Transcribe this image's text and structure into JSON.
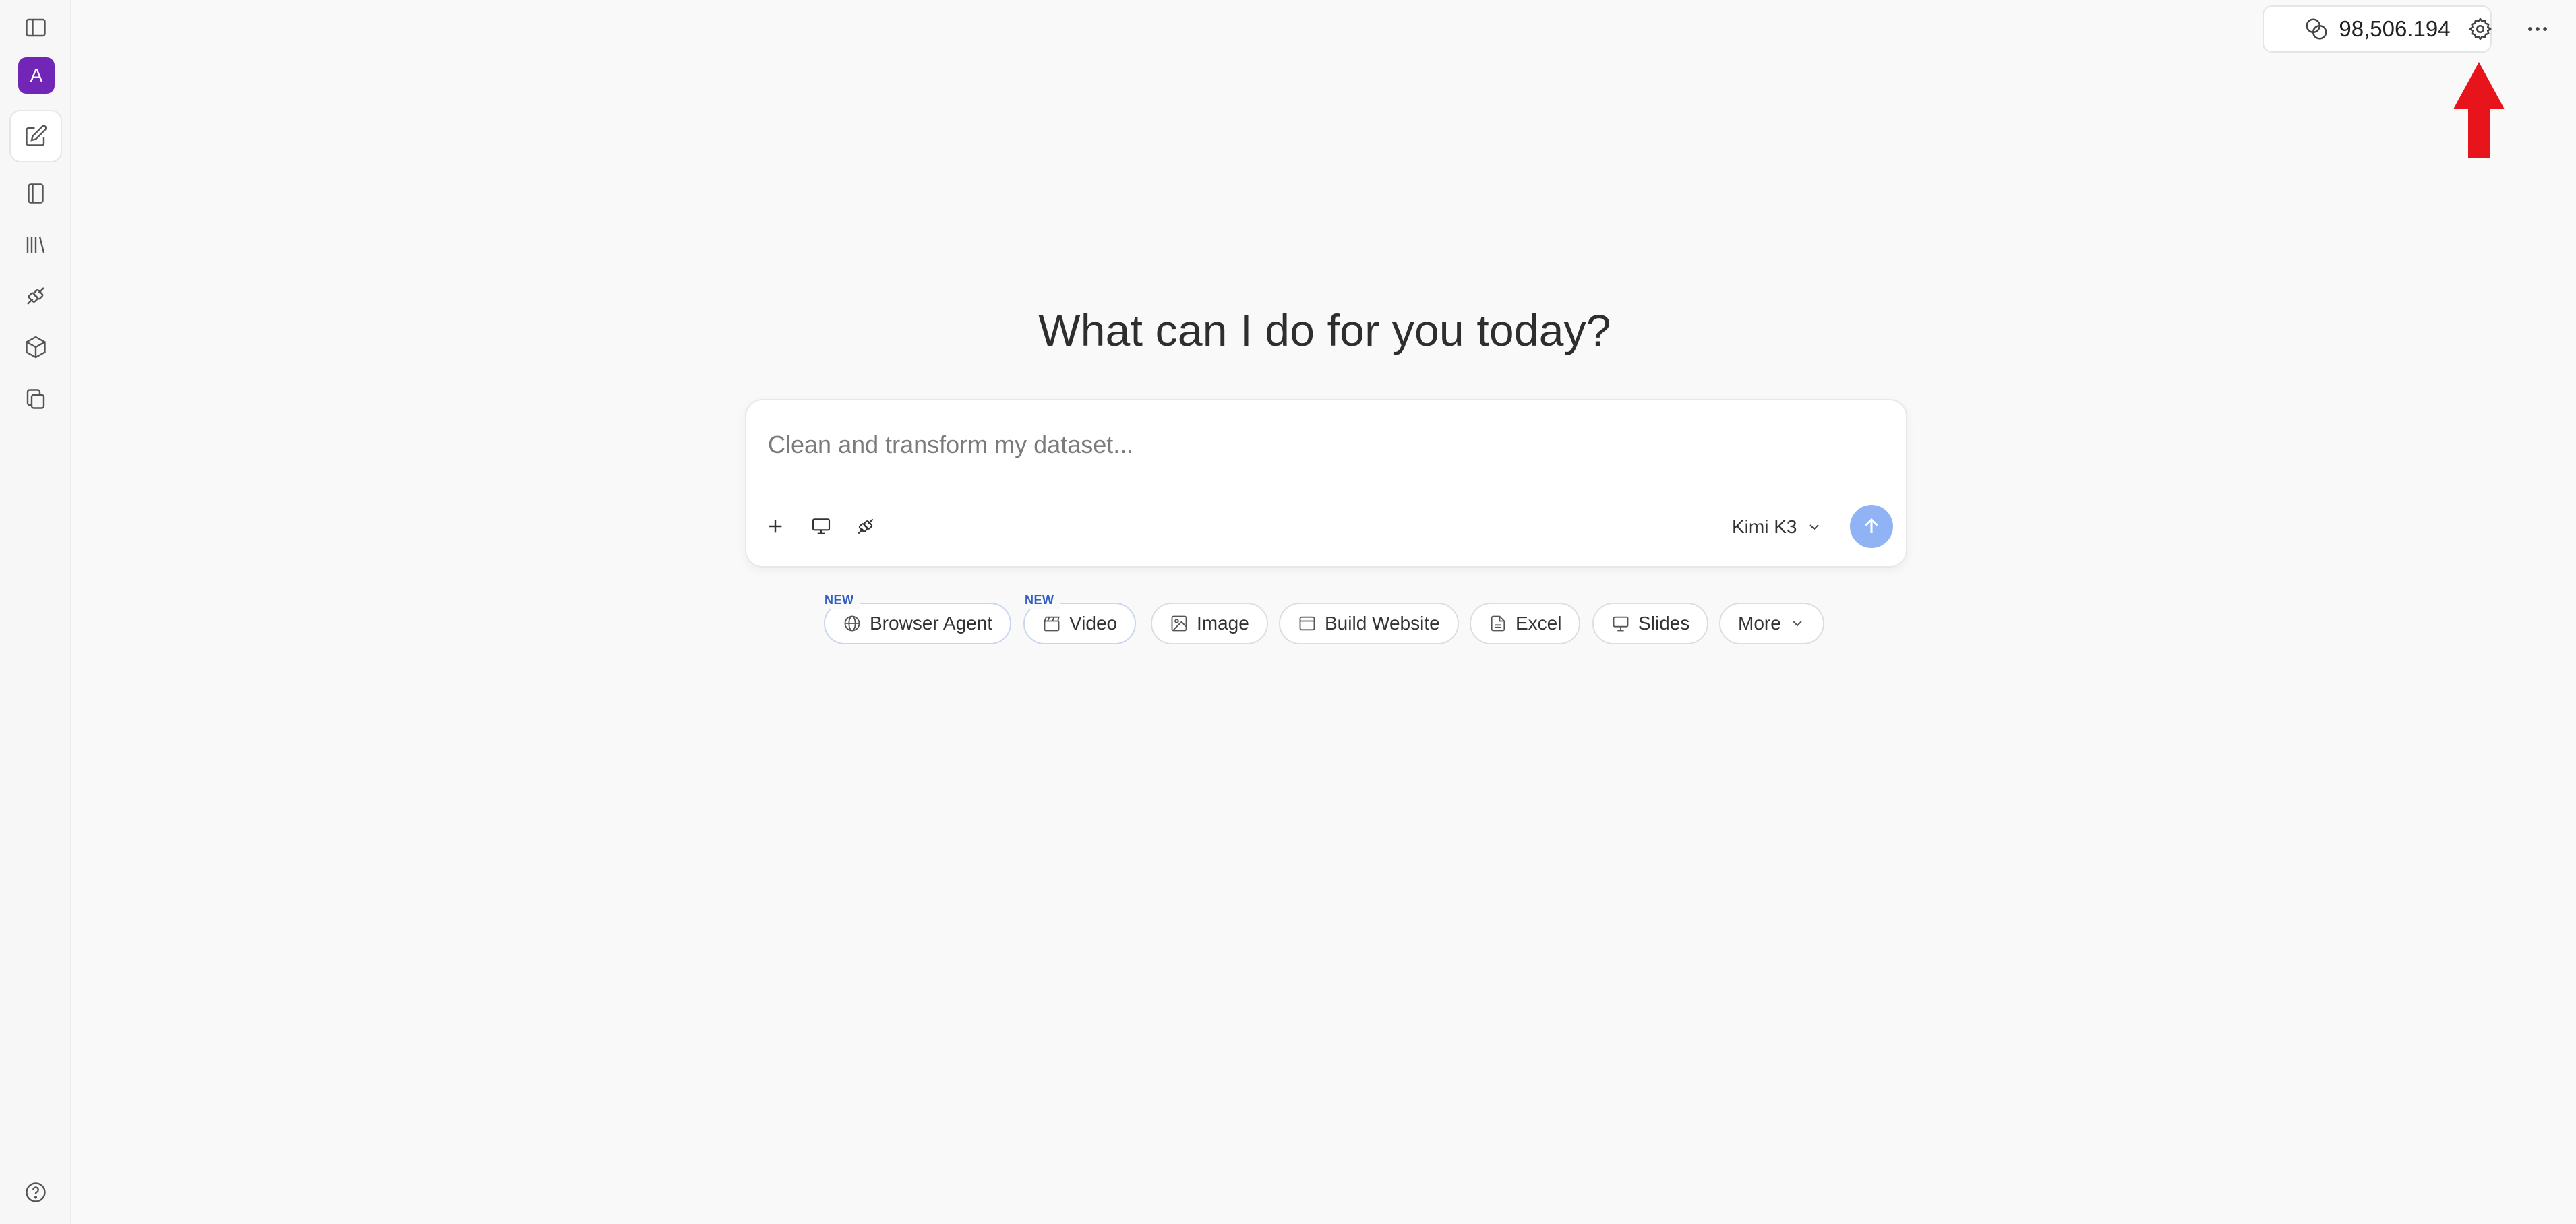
{
  "sidebar": {
    "avatar_letter": "A",
    "items": [
      {
        "icon": "sidebar-toggle-icon"
      },
      {
        "icon": "new-chat-icon"
      },
      {
        "icon": "notebook-icon"
      },
      {
        "icon": "library-icon"
      },
      {
        "icon": "plug-icon"
      },
      {
        "icon": "cube-icon"
      },
      {
        "icon": "copy-icon"
      },
      {
        "icon": "help-icon"
      }
    ]
  },
  "header": {
    "credits": "98,506.194"
  },
  "main": {
    "headline": "What can I do for you today?",
    "composer": {
      "placeholder": "Clean and transform my dataset...",
      "model": "Kimi K3"
    },
    "chips": [
      {
        "label": "Browser Agent",
        "badge": "NEW"
      },
      {
        "label": "Video",
        "badge": "NEW"
      },
      {
        "label": "Image"
      },
      {
        "label": "Build Website"
      },
      {
        "label": "Excel"
      },
      {
        "label": "Slides"
      },
      {
        "label": "More"
      }
    ]
  },
  "colors": {
    "accent_avatar": "#7226b8",
    "send_button": "#8fb3f5",
    "annotation_arrow": "#e8141c",
    "new_badge": "#2f5fc7"
  }
}
